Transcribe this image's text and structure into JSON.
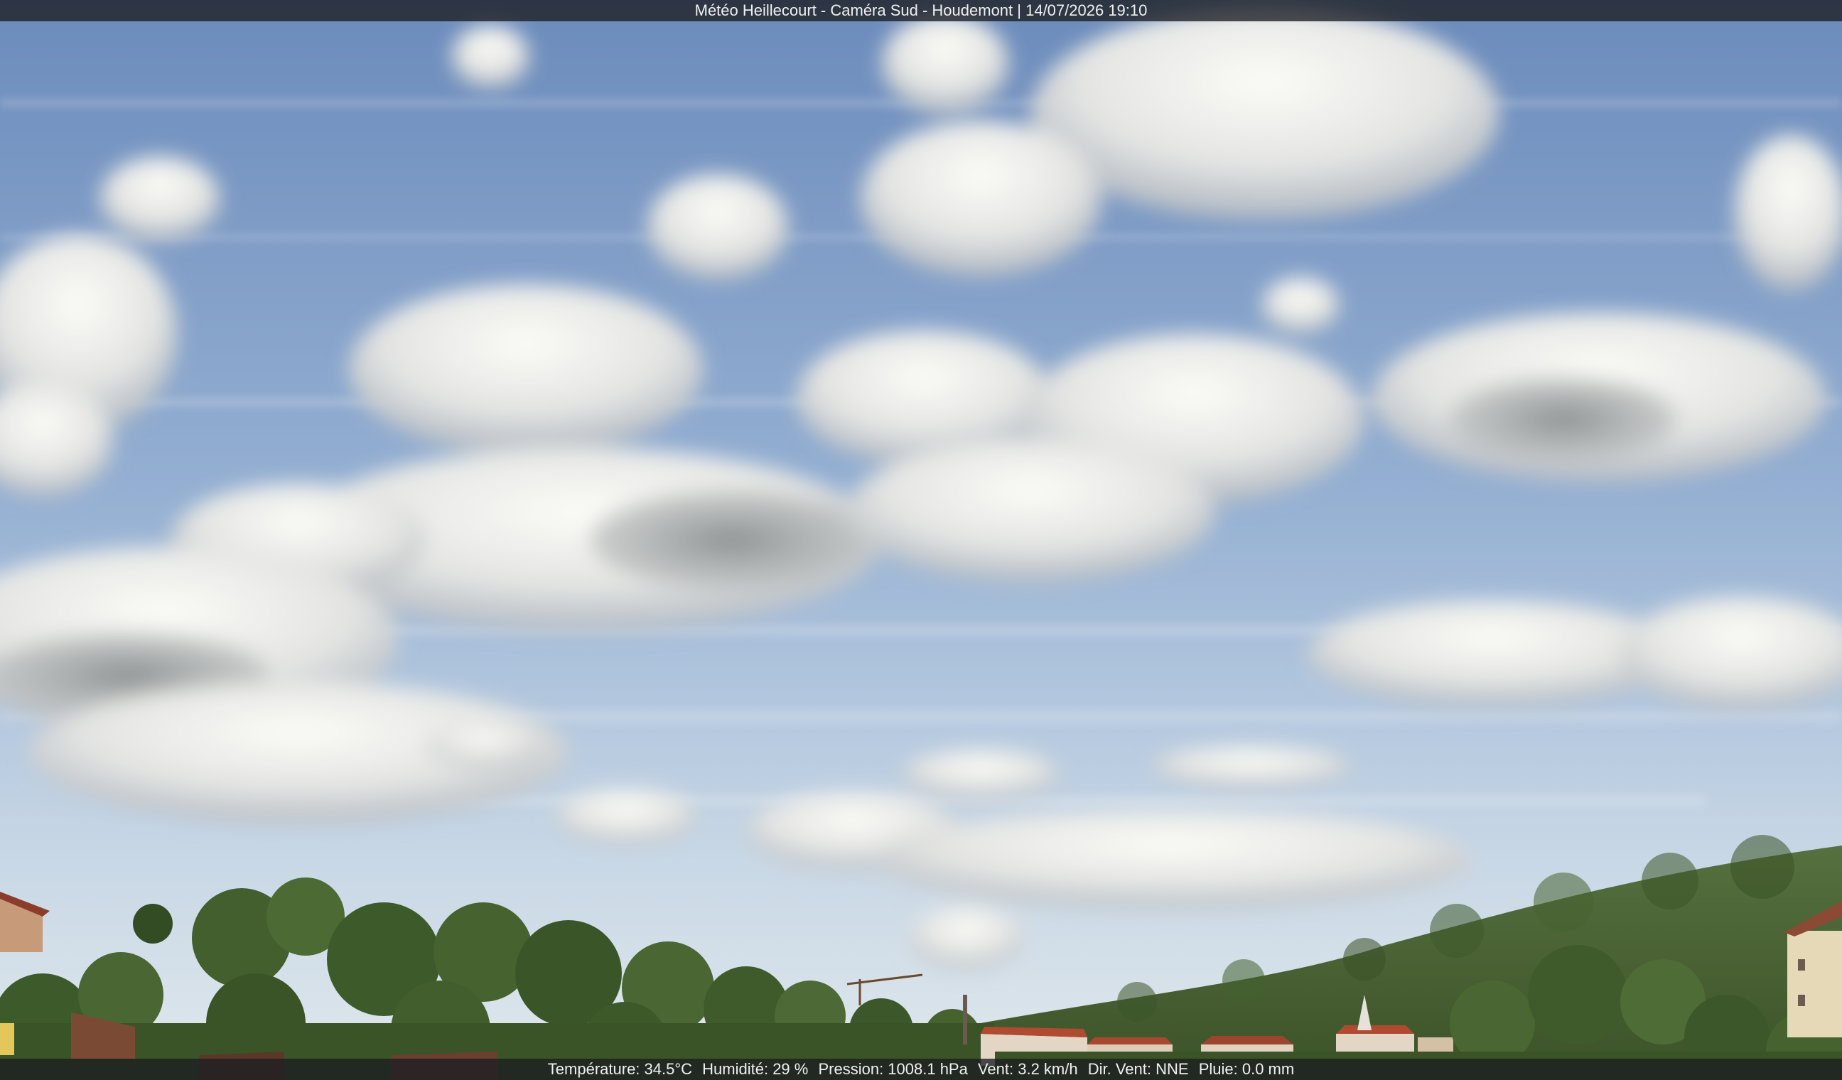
{
  "overlay": {
    "title": "Météo Heillecourt - Caméra Sud - Houdemont | 14/07/2026 19:10"
  },
  "weather": {
    "temperature": "Température: 34.5°C",
    "humidity": "Humidité: 29 %",
    "pressure": "Pression: 1008.1 hPa",
    "wind": "Vent: 3.2 km/h",
    "wind_dir": "Dir. Vent: NNE",
    "rain": "Pluie: 0.0 mm"
  },
  "colors": {
    "sky_top": "#6f8fbf",
    "sky_mid": "#9fb6d6",
    "sky_horizon": "#d7e2ea",
    "cloud": "#f2f2ee",
    "cloud_shadow": "#9a9c9c",
    "trees": "#3f5a2c",
    "hill": "#4e6a3a",
    "roof": "#9c5a3c"
  }
}
